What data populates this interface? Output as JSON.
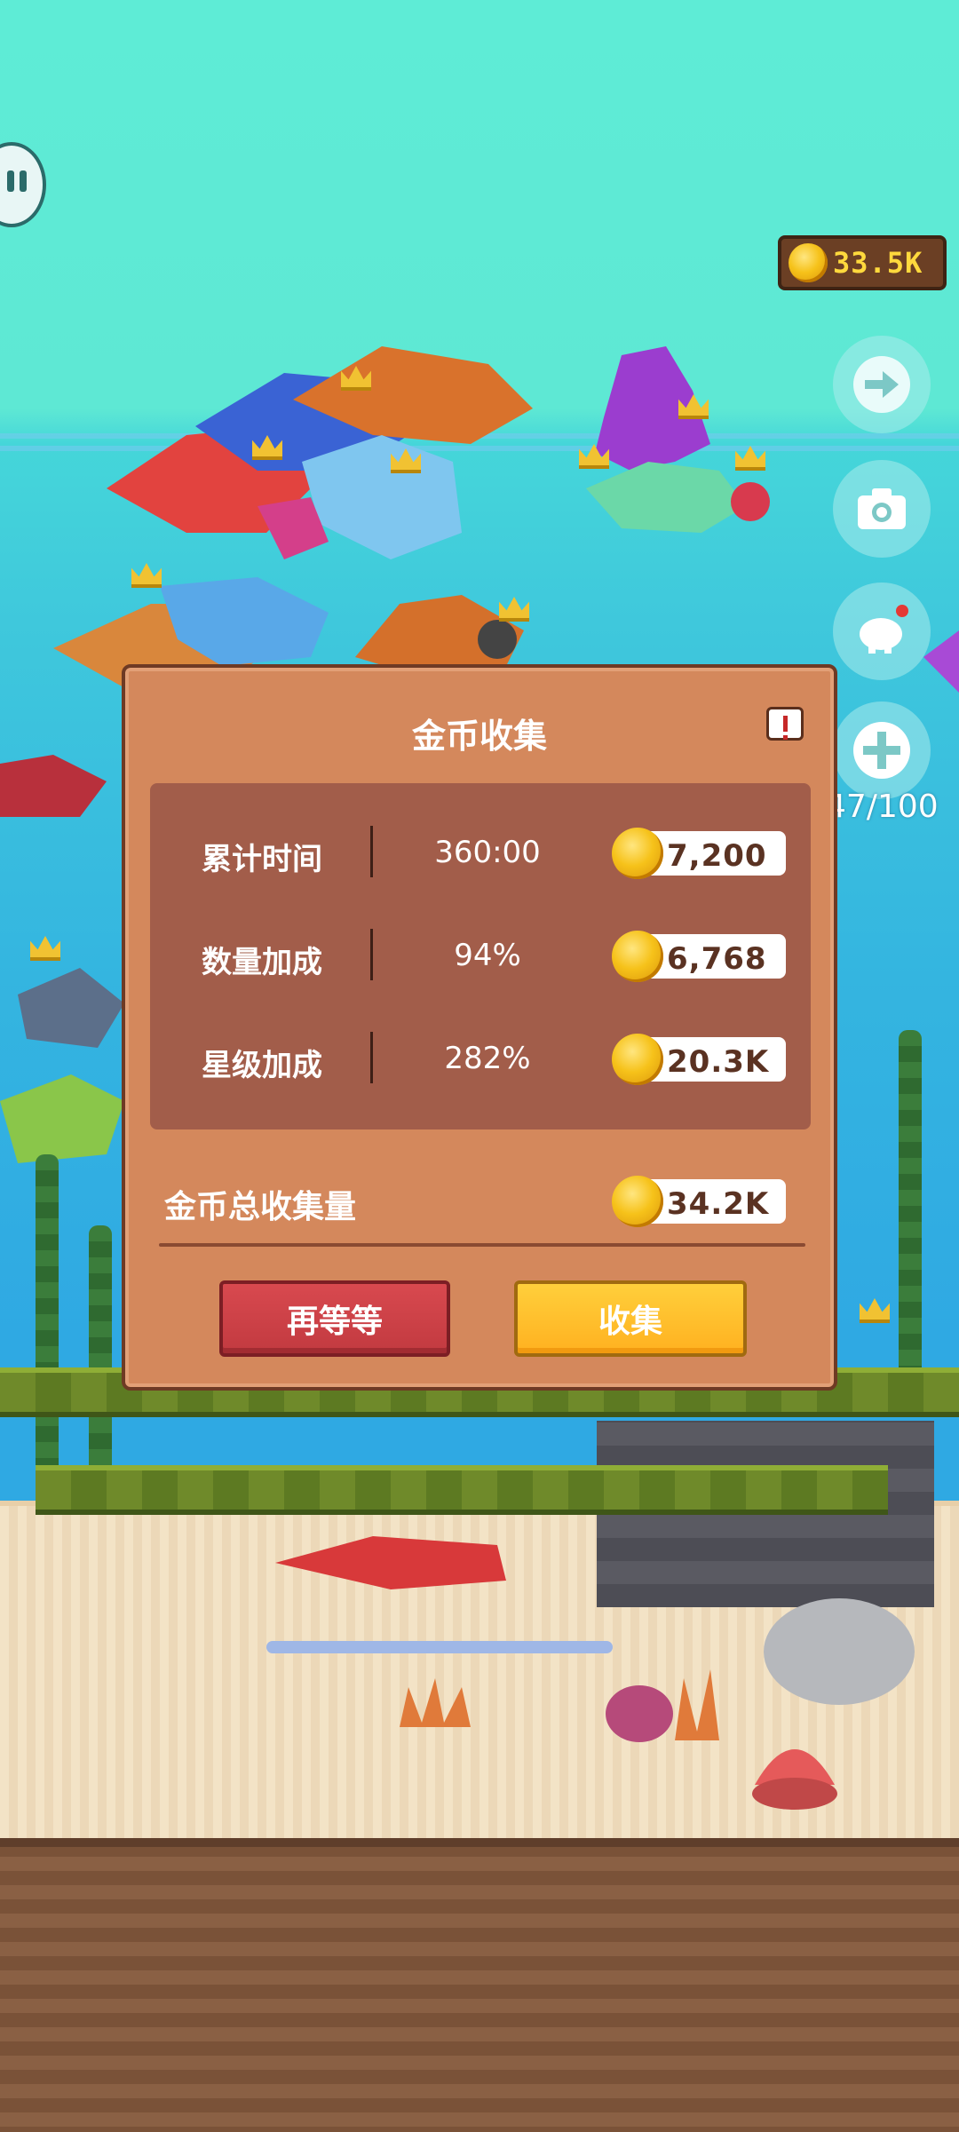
{
  "hud": {
    "coins": "33.5K",
    "fish_count": "47/100"
  },
  "dialog": {
    "title": "金币收集",
    "rows": [
      {
        "label": "累计时间",
        "value": "360:00",
        "coins": "7,200"
      },
      {
        "label": "数量加成",
        "value": "94%",
        "coins": "6,768"
      },
      {
        "label": "星级加成",
        "value": "282%",
        "coins": "20.3K"
      }
    ],
    "total_label": "金币总收集量",
    "total_coins": "34.2K",
    "wait_button": "再等等",
    "collect_button": "收集"
  },
  "colors": {
    "dialog_bg": "#d4885c",
    "panel_bg": "#a25d4a",
    "wait_button": "#c23a40",
    "collect_button": "#ffb120",
    "coin_text": "#ffd93d"
  }
}
